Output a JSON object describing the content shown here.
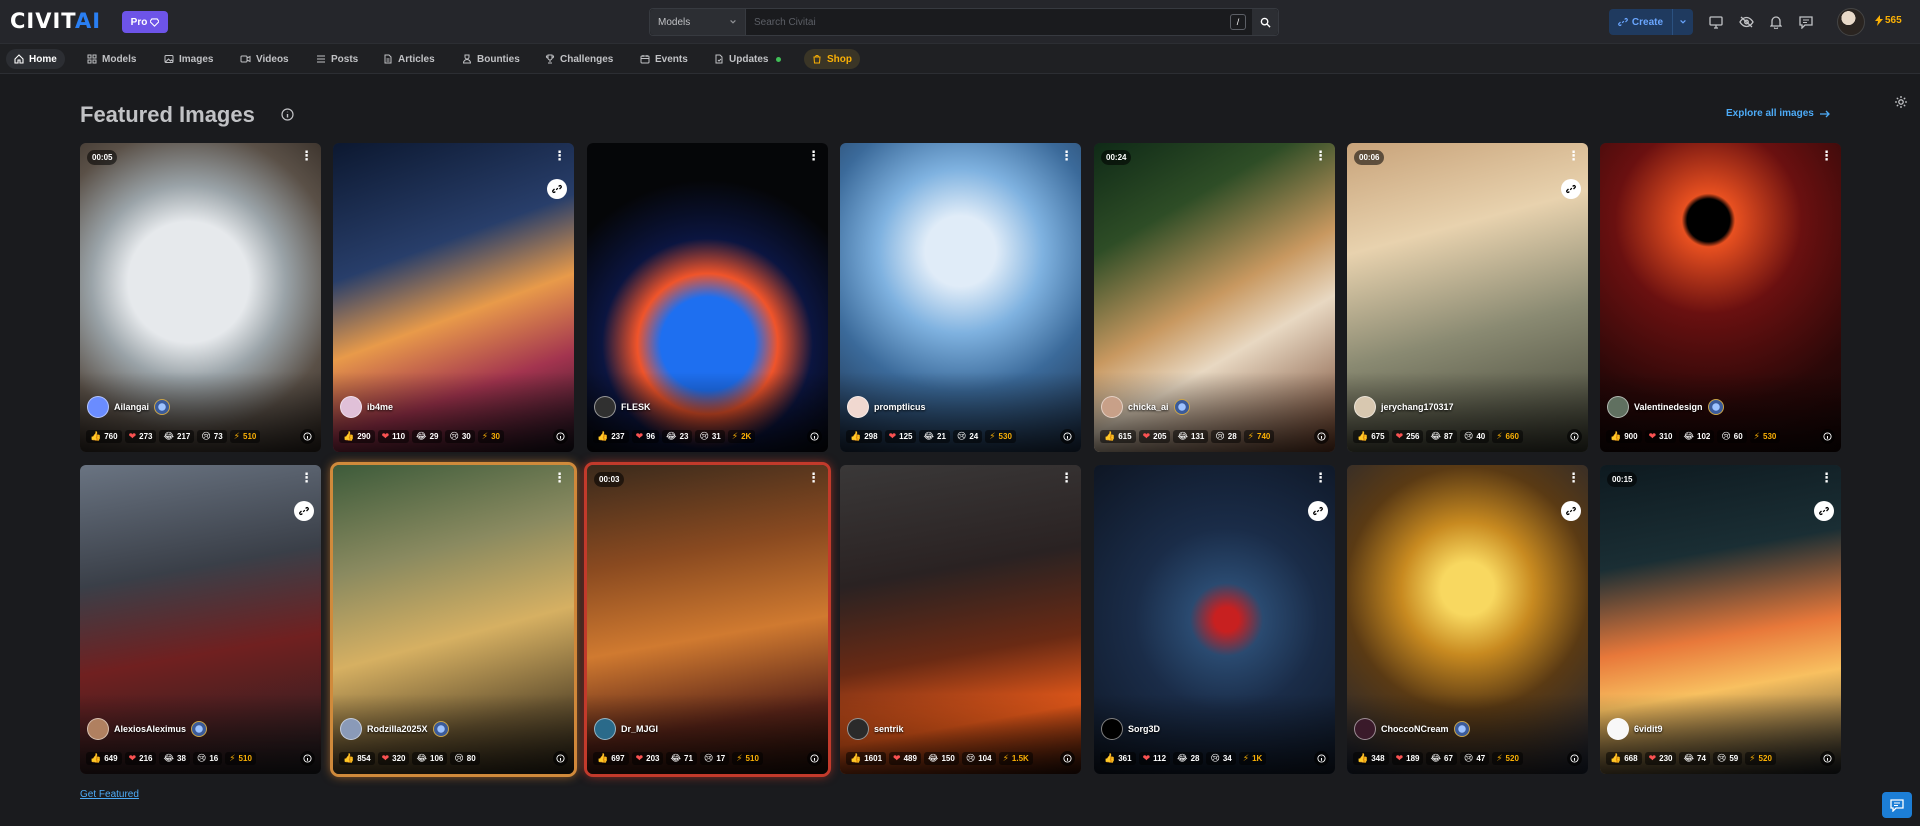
{
  "header": {
    "logo_text_a": "CIVIT",
    "logo_text_b": "AI",
    "pro_label": "Pro",
    "search_category": "Models",
    "search_placeholder": "Search Civitai",
    "slash_key": "/",
    "create_label": "Create",
    "buzz_count": "565"
  },
  "nav": {
    "items": [
      {
        "label": "Home",
        "icon": "home-icon"
      },
      {
        "label": "Models",
        "icon": "models-icon"
      },
      {
        "label": "Images",
        "icon": "image-icon"
      },
      {
        "label": "Videos",
        "icon": "video-icon"
      },
      {
        "label": "Posts",
        "icon": "posts-icon"
      },
      {
        "label": "Articles",
        "icon": "article-icon"
      },
      {
        "label": "Bounties",
        "icon": "bounty-icon"
      },
      {
        "label": "Challenges",
        "icon": "trophy-icon"
      },
      {
        "label": "Events",
        "icon": "calendar-icon"
      },
      {
        "label": "Updates",
        "icon": "updates-icon"
      },
      {
        "label": "Shop",
        "icon": "shop-icon"
      }
    ]
  },
  "main": {
    "title": "Featured Images",
    "explore_link": "Explore all images",
    "get_featured": "Get Featured"
  },
  "cards": [
    {
      "user": "Ailangai",
      "duration": "00:05",
      "remix": false,
      "likes": "760",
      "hearts": "273",
      "laughs": "217",
      "cries": "73",
      "buzz": "510"
    },
    {
      "user": "ib4me",
      "duration": "",
      "remix": true,
      "likes": "290",
      "hearts": "110",
      "laughs": "29",
      "cries": "30",
      "buzz": "30"
    },
    {
      "user": "FLESK",
      "duration": "",
      "remix": false,
      "likes": "237",
      "hearts": "96",
      "laughs": "23",
      "cries": "31",
      "buzz": "2K"
    },
    {
      "user": "promptlicus",
      "duration": "",
      "remix": false,
      "likes": "298",
      "hearts": "125",
      "laughs": "21",
      "cries": "24",
      "buzz": "530"
    },
    {
      "user": "chicka_ai",
      "duration": "00:24",
      "remix": false,
      "likes": "615",
      "hearts": "205",
      "laughs": "131",
      "cries": "28",
      "buzz": "740"
    },
    {
      "user": "jerychang170317",
      "duration": "00:06",
      "remix": true,
      "likes": "675",
      "hearts": "256",
      "laughs": "87",
      "cries": "40",
      "buzz": "660"
    },
    {
      "user": "Valentinedesign",
      "duration": "",
      "remix": false,
      "likes": "900",
      "hearts": "310",
      "laughs": "102",
      "cries": "60",
      "buzz": "530"
    },
    {
      "user": "AlexiosAleximus",
      "duration": "",
      "remix": true,
      "likes": "649",
      "hearts": "216",
      "laughs": "38",
      "cries": "16",
      "buzz": "510"
    },
    {
      "user": "Rodzilla2025X",
      "duration": "",
      "remix": false,
      "likes": "854",
      "hearts": "320",
      "laughs": "106",
      "cries": "80",
      "buzz": ""
    },
    {
      "user": "Dr_MJGI",
      "duration": "00:03",
      "remix": false,
      "likes": "697",
      "hearts": "203",
      "laughs": "71",
      "cries": "17",
      "buzz": "510"
    },
    {
      "user": "sentrik",
      "duration": "",
      "remix": false,
      "likes": "1601",
      "hearts": "489",
      "laughs": "150",
      "cries": "104",
      "buzz": "1.5K"
    },
    {
      "user": "Sorg3D",
      "duration": "",
      "remix": true,
      "likes": "361",
      "hearts": "112",
      "laughs": "28",
      "cries": "34",
      "buzz": "1K"
    },
    {
      "user": "ChoccoNCream",
      "duration": "",
      "remix": true,
      "likes": "348",
      "hearts": "189",
      "laughs": "67",
      "cries": "47",
      "buzz": "520"
    },
    {
      "user": "6vidit9",
      "duration": "00:15",
      "remix": true,
      "likes": "668",
      "hearts": "230",
      "laughs": "74",
      "cries": "59",
      "buzz": "520"
    }
  ],
  "colors": {
    "accent": "#2a7ff3",
    "pro": "#6d54e8",
    "buzz": "#fab005",
    "link": "#4dabf7",
    "background": "#1a1b1e"
  }
}
